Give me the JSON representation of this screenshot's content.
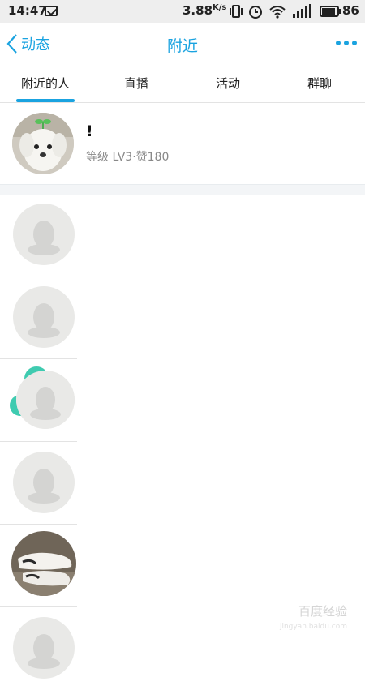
{
  "status_bar": {
    "time": "14:47",
    "net_speed": "3.88",
    "net_speed_unit": "K/s",
    "battery": "86"
  },
  "header": {
    "back_label": "动态",
    "title": "附近",
    "accent_color": "#1aa3e0"
  },
  "tabs": [
    {
      "label": "附近的人",
      "active": true
    },
    {
      "label": "直播",
      "active": false
    },
    {
      "label": "活动",
      "active": false
    },
    {
      "label": "群聊",
      "active": false
    }
  ],
  "my_profile": {
    "name": "!",
    "meta": "等级 LV3·赞180"
  },
  "nearby_people": [
    {
      "avatar": "default-penguin"
    },
    {
      "avatar": "default-penguin"
    },
    {
      "avatar": "default-penguin"
    },
    {
      "avatar": "default-penguin"
    },
    {
      "avatar": "shoe-photo"
    },
    {
      "avatar": "default-penguin"
    }
  ],
  "watermark": {
    "text": "百度经验",
    "sub": "jingyan.baidu.com"
  }
}
